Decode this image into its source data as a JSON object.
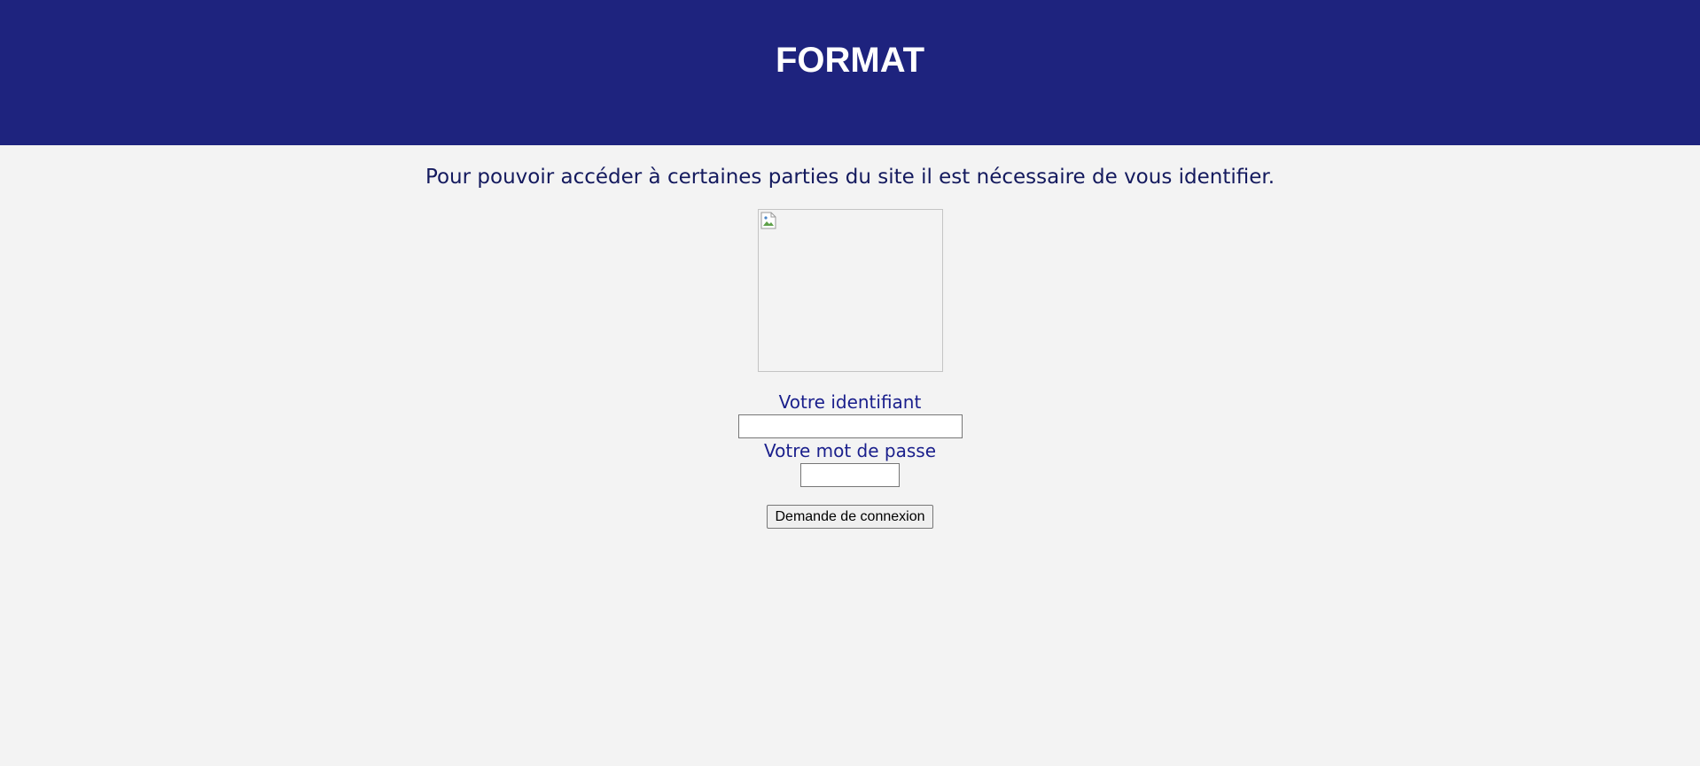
{
  "header": {
    "title": "FORMAT",
    "background_color": "#1e237e"
  },
  "main": {
    "intro_text": "Pour pouvoir accéder à certaines parties du site il est nécessaire de vous identifier.",
    "logo_image": "broken-image-icon",
    "login_form": {
      "identifier_label": "Votre identifiant",
      "identifier_value": "",
      "password_label": "Votre mot de passe",
      "password_value": "",
      "submit_label": "Demande de connexion"
    }
  },
  "colors": {
    "header_bg": "#1e237e",
    "page_bg": "#f3f3f3",
    "label_color": "#1a1f8c"
  }
}
